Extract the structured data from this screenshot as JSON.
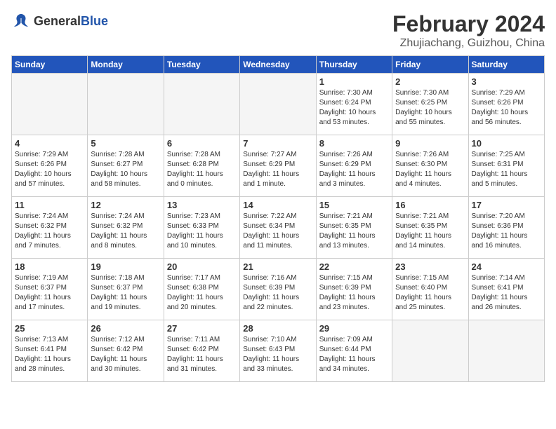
{
  "header": {
    "logo_general": "General",
    "logo_blue": "Blue",
    "month_year": "February 2024",
    "location": "Zhujiachang, Guizhou, China"
  },
  "weekdays": [
    "Sunday",
    "Monday",
    "Tuesday",
    "Wednesday",
    "Thursday",
    "Friday",
    "Saturday"
  ],
  "weeks": [
    [
      {
        "day": "",
        "info": ""
      },
      {
        "day": "",
        "info": ""
      },
      {
        "day": "",
        "info": ""
      },
      {
        "day": "",
        "info": ""
      },
      {
        "day": "1",
        "info": "Sunrise: 7:30 AM\nSunset: 6:24 PM\nDaylight: 10 hours\nand 53 minutes."
      },
      {
        "day": "2",
        "info": "Sunrise: 7:30 AM\nSunset: 6:25 PM\nDaylight: 10 hours\nand 55 minutes."
      },
      {
        "day": "3",
        "info": "Sunrise: 7:29 AM\nSunset: 6:26 PM\nDaylight: 10 hours\nand 56 minutes."
      }
    ],
    [
      {
        "day": "4",
        "info": "Sunrise: 7:29 AM\nSunset: 6:26 PM\nDaylight: 10 hours\nand 57 minutes."
      },
      {
        "day": "5",
        "info": "Sunrise: 7:28 AM\nSunset: 6:27 PM\nDaylight: 10 hours\nand 58 minutes."
      },
      {
        "day": "6",
        "info": "Sunrise: 7:28 AM\nSunset: 6:28 PM\nDaylight: 11 hours\nand 0 minutes."
      },
      {
        "day": "7",
        "info": "Sunrise: 7:27 AM\nSunset: 6:29 PM\nDaylight: 11 hours\nand 1 minute."
      },
      {
        "day": "8",
        "info": "Sunrise: 7:26 AM\nSunset: 6:29 PM\nDaylight: 11 hours\nand 3 minutes."
      },
      {
        "day": "9",
        "info": "Sunrise: 7:26 AM\nSunset: 6:30 PM\nDaylight: 11 hours\nand 4 minutes."
      },
      {
        "day": "10",
        "info": "Sunrise: 7:25 AM\nSunset: 6:31 PM\nDaylight: 11 hours\nand 5 minutes."
      }
    ],
    [
      {
        "day": "11",
        "info": "Sunrise: 7:24 AM\nSunset: 6:32 PM\nDaylight: 11 hours\nand 7 minutes."
      },
      {
        "day": "12",
        "info": "Sunrise: 7:24 AM\nSunset: 6:32 PM\nDaylight: 11 hours\nand 8 minutes."
      },
      {
        "day": "13",
        "info": "Sunrise: 7:23 AM\nSunset: 6:33 PM\nDaylight: 11 hours\nand 10 minutes."
      },
      {
        "day": "14",
        "info": "Sunrise: 7:22 AM\nSunset: 6:34 PM\nDaylight: 11 hours\nand 11 minutes."
      },
      {
        "day": "15",
        "info": "Sunrise: 7:21 AM\nSunset: 6:35 PM\nDaylight: 11 hours\nand 13 minutes."
      },
      {
        "day": "16",
        "info": "Sunrise: 7:21 AM\nSunset: 6:35 PM\nDaylight: 11 hours\nand 14 minutes."
      },
      {
        "day": "17",
        "info": "Sunrise: 7:20 AM\nSunset: 6:36 PM\nDaylight: 11 hours\nand 16 minutes."
      }
    ],
    [
      {
        "day": "18",
        "info": "Sunrise: 7:19 AM\nSunset: 6:37 PM\nDaylight: 11 hours\nand 17 minutes."
      },
      {
        "day": "19",
        "info": "Sunrise: 7:18 AM\nSunset: 6:37 PM\nDaylight: 11 hours\nand 19 minutes."
      },
      {
        "day": "20",
        "info": "Sunrise: 7:17 AM\nSunset: 6:38 PM\nDaylight: 11 hours\nand 20 minutes."
      },
      {
        "day": "21",
        "info": "Sunrise: 7:16 AM\nSunset: 6:39 PM\nDaylight: 11 hours\nand 22 minutes."
      },
      {
        "day": "22",
        "info": "Sunrise: 7:15 AM\nSunset: 6:39 PM\nDaylight: 11 hours\nand 23 minutes."
      },
      {
        "day": "23",
        "info": "Sunrise: 7:15 AM\nSunset: 6:40 PM\nDaylight: 11 hours\nand 25 minutes."
      },
      {
        "day": "24",
        "info": "Sunrise: 7:14 AM\nSunset: 6:41 PM\nDaylight: 11 hours\nand 26 minutes."
      }
    ],
    [
      {
        "day": "25",
        "info": "Sunrise: 7:13 AM\nSunset: 6:41 PM\nDaylight: 11 hours\nand 28 minutes."
      },
      {
        "day": "26",
        "info": "Sunrise: 7:12 AM\nSunset: 6:42 PM\nDaylight: 11 hours\nand 30 minutes."
      },
      {
        "day": "27",
        "info": "Sunrise: 7:11 AM\nSunset: 6:42 PM\nDaylight: 11 hours\nand 31 minutes."
      },
      {
        "day": "28",
        "info": "Sunrise: 7:10 AM\nSunset: 6:43 PM\nDaylight: 11 hours\nand 33 minutes."
      },
      {
        "day": "29",
        "info": "Sunrise: 7:09 AM\nSunset: 6:44 PM\nDaylight: 11 hours\nand 34 minutes."
      },
      {
        "day": "",
        "info": ""
      },
      {
        "day": "",
        "info": ""
      }
    ]
  ]
}
